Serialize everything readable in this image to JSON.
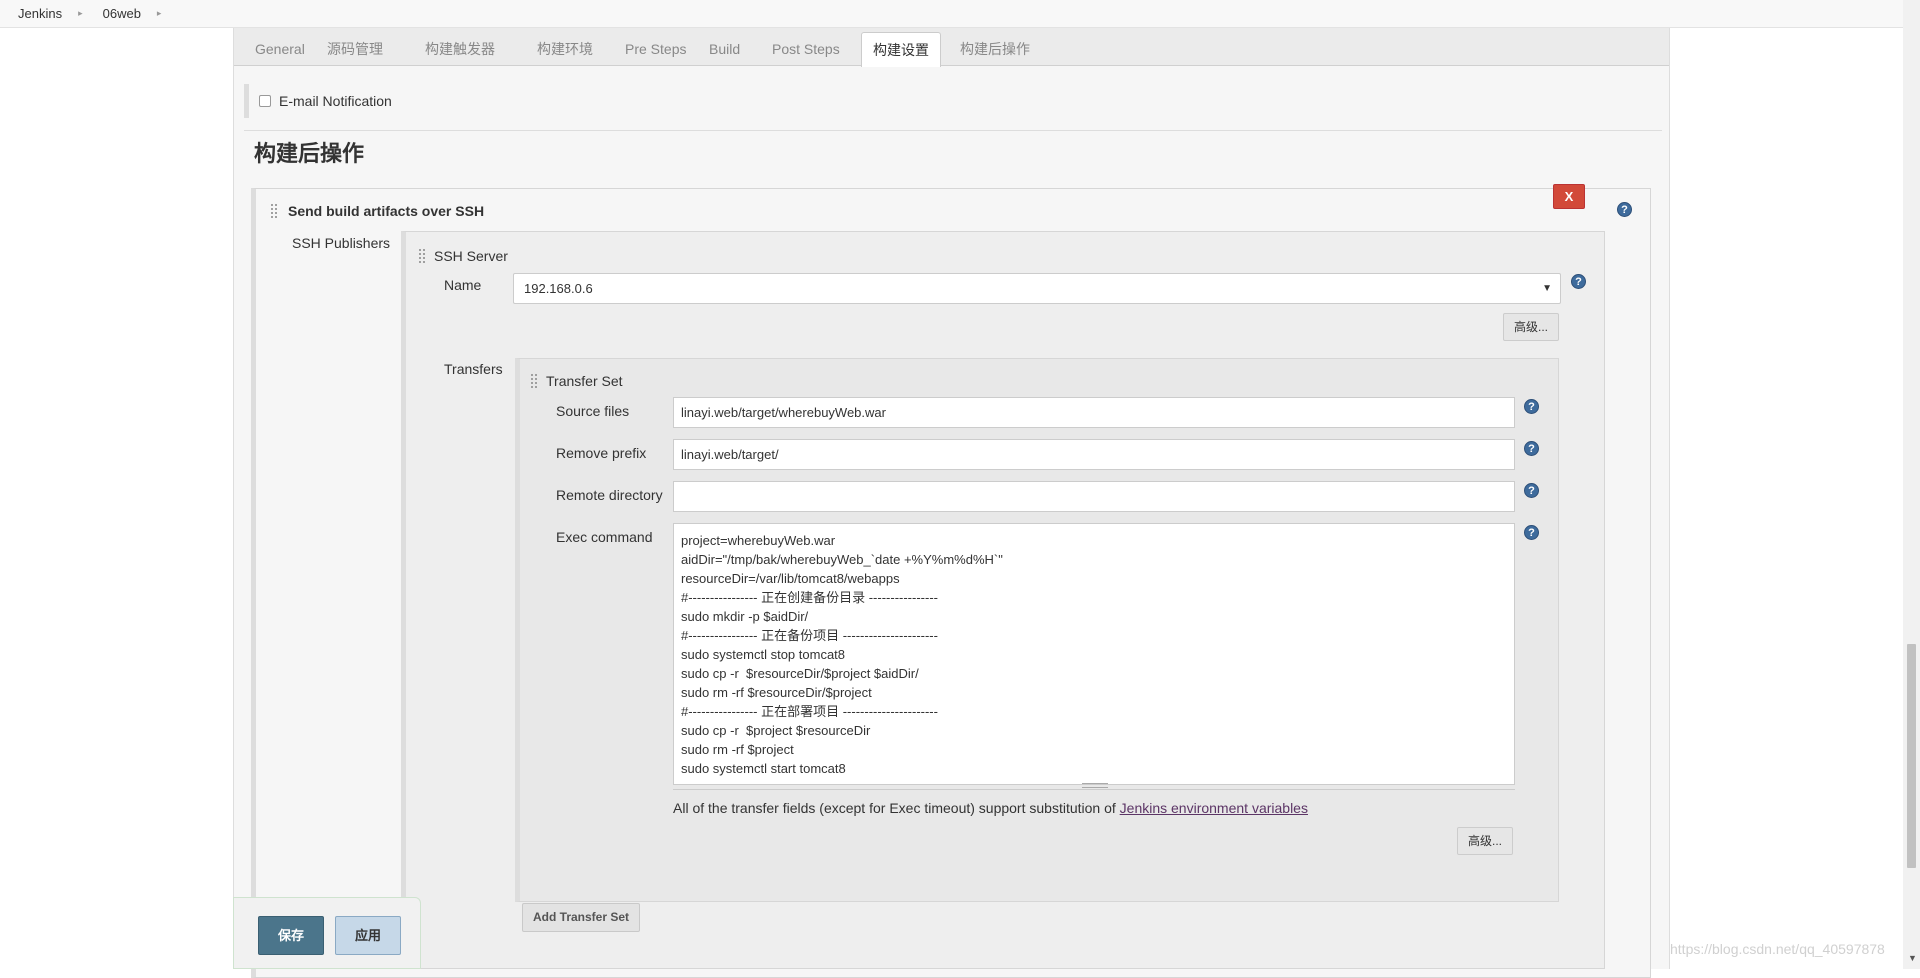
{
  "breadcrumb": {
    "items": [
      "Jenkins",
      "06web"
    ]
  },
  "tabs": [
    "General",
    "源码管理",
    "构建触发器",
    "构建环境",
    "Pre Steps",
    "Build",
    "Post Steps",
    "构建设置",
    "构建后操作"
  ],
  "email_notification": {
    "label": "E-mail Notification",
    "checked": false
  },
  "section_title": "构建后操作",
  "ssh": {
    "title": "Send build artifacts over SSH",
    "close_label": "X",
    "publishers_label": "SSH Publishers",
    "server_label": "SSH Server",
    "name_label": "Name",
    "name_value": "192.168.0.6",
    "advanced_label": "高级...",
    "transfers_label": "Transfers",
    "transfer_set_label": "Transfer Set",
    "source_files_label": "Source files",
    "source_files_value": "linayi.web/target/wherebuyWeb.war",
    "remove_prefix_label": "Remove prefix",
    "remove_prefix_value": "linayi.web/target/",
    "remote_directory_label": "Remote directory",
    "remote_directory_value": "",
    "exec_command_label": "Exec command",
    "exec_command_lines": [
      "project=wherebuyWeb.war",
      "aidDir=\"/tmp/bak/wherebuyWeb_`date +%Y%m%d%H`\"",
      "resourceDir=/var/lib/tomcat8/webapps",
      "#---------------- 正在创建备份目录 ----------------",
      "sudo mkdir -p $aidDir/",
      "#---------------- 正在备份项目 ----------------------",
      "sudo systemctl stop tomcat8",
      "sudo cp -r  $resourceDir/$project $aidDir/",
      "sudo rm -rf $resourceDir/$project",
      "#---------------- 正在部署项目 ----------------------",
      "sudo cp -r  $project $resourceDir",
      "sudo rm -rf $project",
      "sudo systemctl start tomcat8"
    ],
    "env_note_prefix": "All of the transfer fields (except for Exec timeout) support substitution of ",
    "env_note_link": "Jenkins environment variables",
    "transfer_advanced_label": "高级...",
    "add_transfer_label": "Add Transfer Set"
  },
  "help_label": "?",
  "buttons": {
    "save": "保存",
    "apply": "应用"
  },
  "watermark": "https://blog.csdn.net/qq_40597878",
  "colors": {
    "save": "#4b758b",
    "apply": "#c6d8e8",
    "close": "#d24939",
    "help": "#3e6b9c",
    "link": "#5c3566"
  }
}
